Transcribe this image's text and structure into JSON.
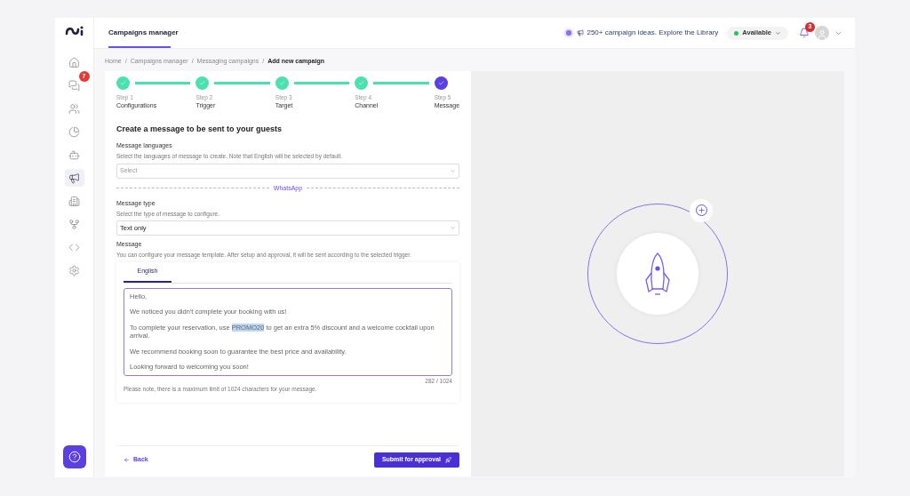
{
  "header": {
    "title": "Campaigns manager",
    "library_link": "250+ campaign ideas. Explore the Library",
    "status": {
      "label": "Available",
      "color": "#22c55e"
    },
    "notifications": "3"
  },
  "sidebar": {
    "items": [
      {
        "kind": "home",
        "selected": false
      },
      {
        "kind": "chat",
        "selected": false,
        "badge": "7"
      },
      {
        "kind": "users",
        "selected": false
      },
      {
        "kind": "chart",
        "selected": false
      },
      {
        "kind": "bot",
        "selected": false
      },
      {
        "kind": "megaphone",
        "selected": true
      },
      {
        "kind": "building",
        "selected": false
      },
      {
        "kind": "flow",
        "selected": false
      },
      {
        "kind": "code",
        "selected": false
      },
      {
        "kind": "settings",
        "selected": false
      }
    ]
  },
  "breadcrumb": {
    "separator": "/",
    "items": [
      "Home",
      "Campaigns manager",
      "Messaging campaigns",
      "Add new campaign"
    ]
  },
  "steps": [
    {
      "step": "Step 1",
      "label": "Configurations",
      "done": true
    },
    {
      "step": "Step 2",
      "label": "Trigger",
      "done": true
    },
    {
      "step": "Step 3",
      "label": "Target",
      "done": true
    },
    {
      "step": "Step 4",
      "label": "Channel",
      "done": true
    },
    {
      "step": "Step 5",
      "label": "Message",
      "done": false
    }
  ],
  "form": {
    "title": "Create a message to be sent to your guests",
    "languages": {
      "label": "Message languages",
      "hint": "Select the languages of message to create. Note that English will be selected by default.",
      "placeholder": "Select"
    },
    "divider": "WhatsApp",
    "type": {
      "label": "Message type",
      "hint": "Select the type of message to configure.",
      "value": "Text only"
    },
    "message": {
      "label": "Message",
      "hint": "You can configure your message template. After setup and approval, it will be sent according to the selected trigger.",
      "tabs": [
        {
          "label": "English",
          "selected": true
        }
      ],
      "paragraphs": [
        {
          "text": "Hello,"
        },
        {
          "text": "We noticed you didn't complete your booking with us!"
        },
        {
          "before": "To complete your reservation, use ",
          "highlight": "PROMO20",
          "after": " to get an extra 5% discount and a welcome cocktail upon arrival."
        },
        {
          "text": "We recommend booking soon to guarantee the best price and availability."
        },
        {
          "text": "Looking forward to welcoming you soon!"
        }
      ],
      "counter": "282 / 1024",
      "note": "Please note, there is a maximum limit of 1024 characters for your message."
    }
  },
  "footer": {
    "back": "Back",
    "submit": "Submit for approval"
  }
}
